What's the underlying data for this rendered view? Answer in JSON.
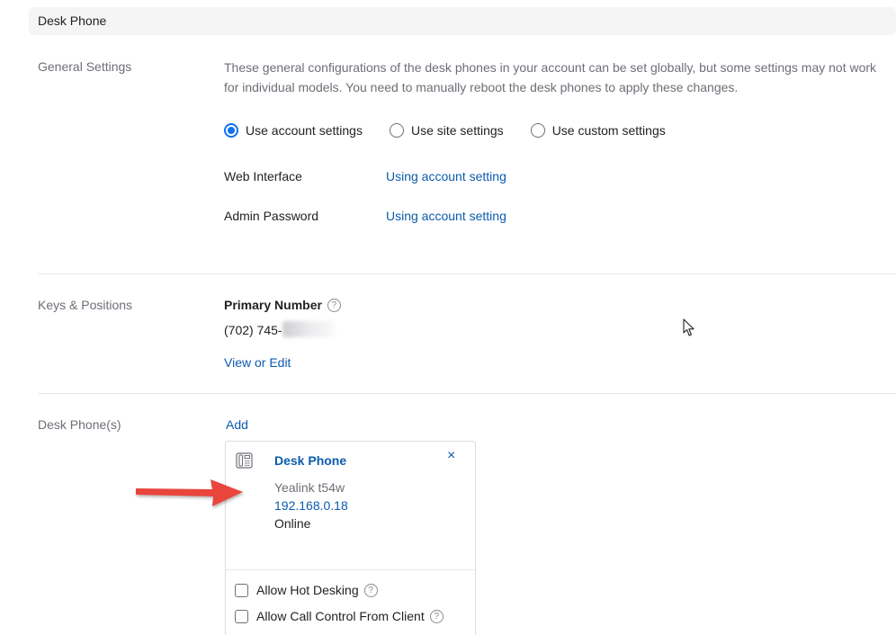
{
  "header": {
    "title": "Desk Phone"
  },
  "general": {
    "label": "General Settings",
    "description": "These general configurations of the desk phones in your account can be set globally, but some settings may not work for individual models. You need to manually reboot the desk phones to apply these changes.",
    "radios": [
      {
        "label": "Use account settings",
        "checked": true
      },
      {
        "label": "Use site settings",
        "checked": false
      },
      {
        "label": "Use custom settings",
        "checked": false
      }
    ],
    "web_interface": {
      "label": "Web Interface",
      "value": "Using account setting"
    },
    "admin_password": {
      "label": "Admin Password",
      "value": "Using account setting"
    }
  },
  "keys": {
    "label": "Keys & Positions",
    "primary_title": "Primary Number",
    "help_glyph": "?",
    "number": "(702) 745-",
    "view_edit": "View or Edit"
  },
  "desk_phones": {
    "label": "Desk Phone(s)",
    "add": "Add",
    "card": {
      "title": "Desk Phone",
      "close_glyph": "×",
      "model": "Yealink t54w",
      "ip": "192.168.0.18",
      "status": "Online",
      "options": [
        {
          "label": "Allow Hot Desking",
          "checked": false
        },
        {
          "label": "Allow Call Control From Client",
          "checked": false
        }
      ]
    }
  },
  "colors": {
    "accent": "#0e72ed",
    "link": "#0b5cad",
    "annotation_arrow": "#e8453c"
  },
  "icons": {
    "phone": "desk-phone-icon",
    "close": "close-icon",
    "help": "help-icon",
    "cursor": "mouse-pointer-icon"
  }
}
